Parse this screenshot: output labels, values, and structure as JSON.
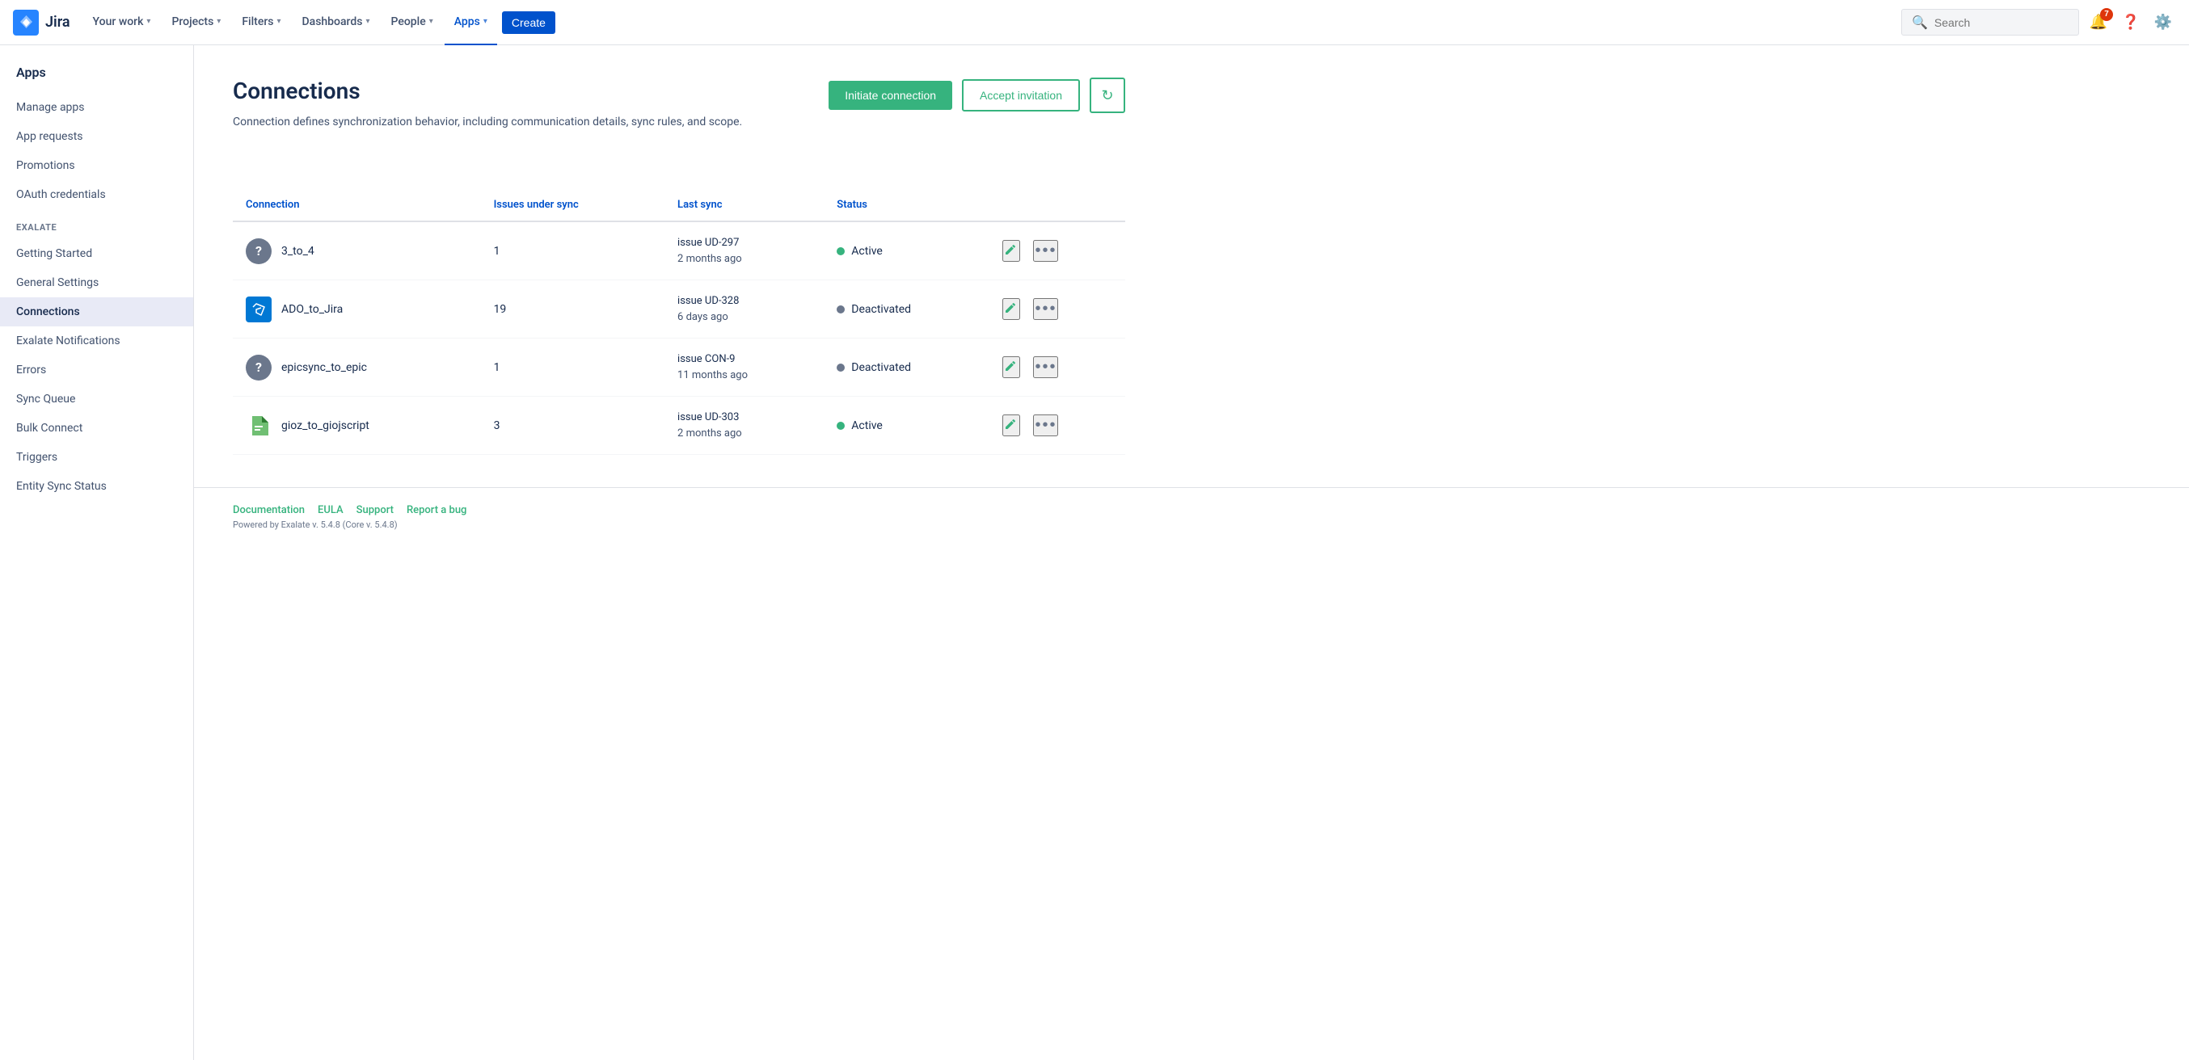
{
  "topnav": {
    "logo_text": "Jira",
    "nav_items": [
      {
        "label": "Your work",
        "has_chevron": true,
        "active": false
      },
      {
        "label": "Projects",
        "has_chevron": true,
        "active": false
      },
      {
        "label": "Filters",
        "has_chevron": true,
        "active": false
      },
      {
        "label": "Dashboards",
        "has_chevron": true,
        "active": false
      },
      {
        "label": "People",
        "has_chevron": true,
        "active": false
      },
      {
        "label": "Apps",
        "has_chevron": true,
        "active": true
      }
    ],
    "create_label": "Create",
    "search_placeholder": "Search",
    "notification_count": "7"
  },
  "sidebar": {
    "apps_label": "Apps",
    "items_top": [
      {
        "label": "Manage apps"
      },
      {
        "label": "App requests"
      },
      {
        "label": "Promotions"
      },
      {
        "label": "OAuth credentials"
      }
    ],
    "section_label": "EXALATE",
    "items_exalate": [
      {
        "label": "Getting Started",
        "active": false
      },
      {
        "label": "General Settings",
        "active": false
      },
      {
        "label": "Connections",
        "active": true
      },
      {
        "label": "Exalate Notifications",
        "active": false
      },
      {
        "label": "Errors",
        "active": false
      },
      {
        "label": "Sync Queue",
        "active": false
      },
      {
        "label": "Bulk Connect",
        "active": false
      },
      {
        "label": "Triggers",
        "active": false
      },
      {
        "label": "Entity Sync Status",
        "active": false
      }
    ]
  },
  "main": {
    "page_title": "Connections",
    "page_desc": "Connection defines synchronization behavior, including communication details, sync rules, and scope.",
    "btn_initiate": "Initiate connection",
    "btn_accept": "Accept invitation",
    "btn_refresh_icon": "↻",
    "table_headers": {
      "connection": "Connection",
      "issues_under_sync": "Issues under sync",
      "last_sync": "Last sync",
      "status": "Status"
    },
    "connections": [
      {
        "name": "3_to_4",
        "icon_type": "question",
        "icon_label": "?",
        "issues": "1",
        "last_sync_issue": "issue UD-297",
        "last_sync_ago": "2 months ago",
        "status": "Active",
        "status_active": true
      },
      {
        "name": "ADO_to_Jira",
        "icon_type": "ado",
        "icon_label": "□",
        "issues": "19",
        "last_sync_issue": "issue UD-328",
        "last_sync_ago": "6 days ago",
        "status": "Deactivated",
        "status_active": false
      },
      {
        "name": "epicsync_to_epic",
        "icon_type": "question",
        "icon_label": "?",
        "issues": "1",
        "last_sync_issue": "issue CON-9",
        "last_sync_ago": "11 months ago",
        "status": "Deactivated",
        "status_active": false
      },
      {
        "name": "gioz_to_giojscript",
        "icon_type": "gioz",
        "icon_label": "🔖",
        "issues": "3",
        "last_sync_issue": "issue UD-303",
        "last_sync_ago": "2 months ago",
        "status": "Active",
        "status_active": true
      }
    ]
  },
  "footer": {
    "links": [
      "Documentation",
      "EULA",
      "Support",
      "Report a bug"
    ],
    "powered": "Powered by Exalate v. 5.4.8 (Core v. 5.4.8)"
  }
}
